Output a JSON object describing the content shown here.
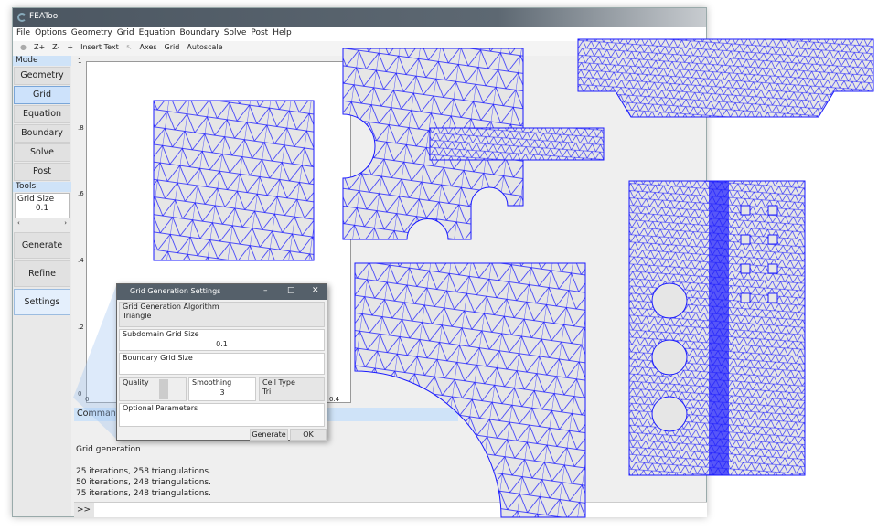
{
  "app": {
    "title": "FEATool"
  },
  "menu": [
    "File",
    "Options",
    "Geometry",
    "Grid",
    "Equation",
    "Boundary",
    "Solve",
    "Post",
    "Help"
  ],
  "toolbar": [
    "Z+",
    "Z-",
    "+",
    "Insert Text",
    "Axes",
    "Grid",
    "Autoscale"
  ],
  "sidebar": {
    "mode_label": "Mode",
    "modes": [
      "Geometry",
      "Grid",
      "Equation",
      "Boundary",
      "Solve",
      "Post"
    ],
    "active": "Grid",
    "tools_label": "Tools",
    "grid_size_label": "Grid Size",
    "grid_size_value": "0.1",
    "buttons": [
      "Generate",
      "Refine",
      "Settings"
    ]
  },
  "plot": {
    "yticks": [
      "1",
      ".8",
      ".6",
      ".4",
      ".2",
      "0"
    ],
    "xticks": [
      "0",
      "0.4"
    ]
  },
  "command": {
    "header": "Command",
    "lines": [
      "Grid generation",
      "",
      "25 iterations, 258 triangulations.",
      "50 iterations, 248 triangulations.",
      "75 iterations, 248 triangulations."
    ],
    "prompt": ">>"
  },
  "dialog": {
    "title": "Grid Generation Settings",
    "algorithm_label": "Grid Generation Algorithm",
    "algorithm_value": "Triangle",
    "subdomain_label": "Subdomain Grid Size",
    "subdomain_value": "0.1",
    "boundary_label": "Boundary Grid Size",
    "boundary_value": "",
    "quality_label": "Quality",
    "smoothing_label": "Smoothing",
    "smoothing_value": "3",
    "celltype_label": "Cell Type",
    "celltype_value": "Tri",
    "optional_label": "Optional Parameters",
    "generate": "Generate",
    "ok": "OK"
  },
  "colors": {
    "mesh": "#1a1aff",
    "mesh_fill": "#e6e6e6",
    "accent": "#cfe3f8"
  }
}
